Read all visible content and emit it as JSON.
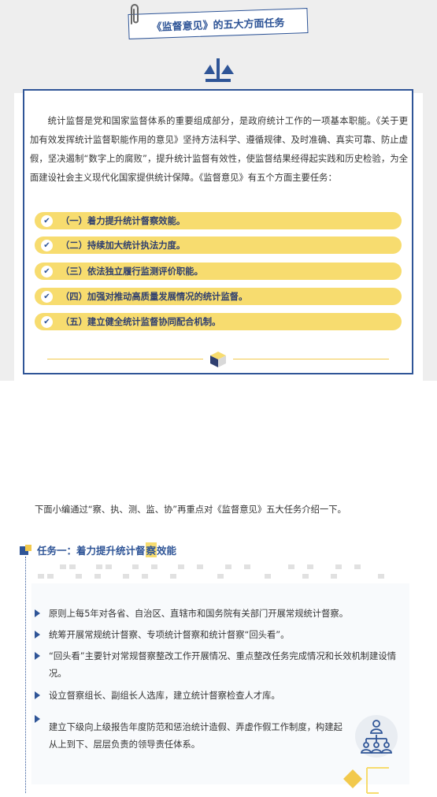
{
  "title": "《监督意见》的五大方面任务",
  "intro": "统计监督是党和国家监督体系的重要组成部分，是政府统计工作的一项基本职能。《关于更加有效发挥统计监督职能作用的意见》坚持方法科学、遵循规律、及时准确、真实可靠、防止虚假，坚决遏制“数字上的腐败”，提升统计监督有效性，使监督结果经得起实践和历史检验，为全面建设社会主义现代化国家提供统计保障。《监督意见》有五个方面主要任务：",
  "tasks": [
    "（一）着力提升统计督察效能。",
    "（二）持续加大统计执法力度。",
    "（三）依法独立履行监测评价职能。",
    "（四）加强对推动高质量发展情况的统计监督。",
    "（五）建立健全统计监督协同配合机制。"
  ],
  "lead": "下面小编通过“察、执、测、监、协”再重点对《监督意见》五大任务介绍一下。",
  "section1": {
    "heading_pre": "任务一：着力提升统计督",
    "heading_hl": "察",
    "heading_post": "效能",
    "bullets": [
      "原则上每5年对各省、自治区、直辖市和国务院有关部门开展常规统计督察。",
      "统筹开展常规统计督察、专项统计督察和统计督察“回头看”。",
      "“回头看”主要针对常规督察整改工作开展情况、重点整改任务完成情况和长效机制建设情况。",
      "设立督察组长、副组长人选库，建立统计督察检查人才库。",
      "建立下级向上级报告年度防范和惩治统计造假、弄虚作假工作制度，构建起从上到下、层层负责的领导责任体系。"
    ]
  },
  "colors": {
    "primary": "#2f5597",
    "accent": "#f7dc6f",
    "grey": "#eeeeee"
  },
  "icons": [
    "paperclip-icon",
    "scale-icon",
    "check-icon",
    "cube-icon",
    "triangle-bullet-icon",
    "org-chart-icon"
  ]
}
